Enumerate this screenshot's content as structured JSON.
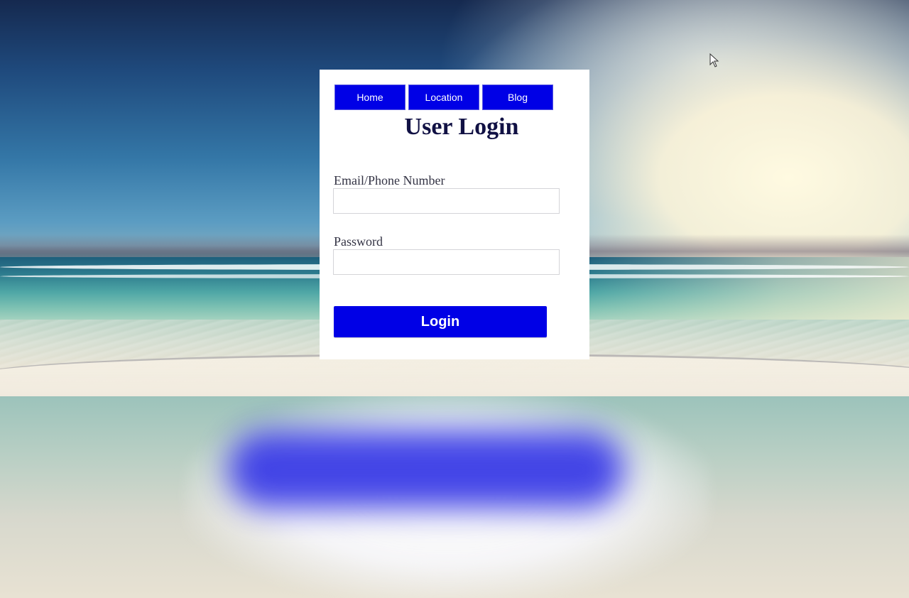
{
  "nav": {
    "items": [
      {
        "label": "Home"
      },
      {
        "label": "Location"
      },
      {
        "label": "Blog"
      }
    ]
  },
  "login": {
    "title": "User Login",
    "email_label": "Email/Phone Number",
    "email_value": "",
    "email_placeholder": "",
    "password_label": "Password",
    "password_value": "",
    "password_placeholder": "",
    "submit_label": "Login"
  },
  "colors": {
    "accent": "#0000e6",
    "title": "#111144",
    "card_bg": "#ffffff"
  },
  "icons": {
    "cursor": "mouse-pointer-icon"
  }
}
